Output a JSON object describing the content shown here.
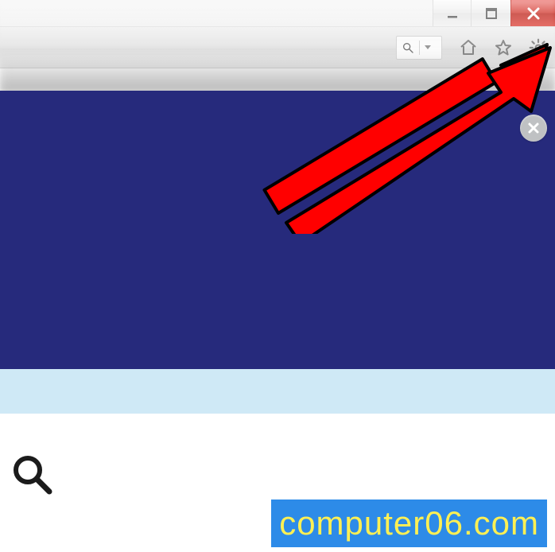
{
  "window": {
    "controls": {
      "minimize": "minimize-icon",
      "maximize": "maximize-icon",
      "close": "close-icon"
    }
  },
  "toolbar": {
    "search": {
      "placeholder": ""
    },
    "icons": {
      "search_dropdown": "search-dropdown-icon",
      "magnifier": "search-icon",
      "home": "home-icon",
      "star": "favorite-icon",
      "gear": "gear-icon"
    }
  },
  "content": {
    "close_banner": "close-icon"
  },
  "bottom": {
    "magnifier": "search-icon"
  },
  "watermark": {
    "text": "computer06.com"
  },
  "annotation": {
    "target": "gear-icon"
  },
  "colors": {
    "navy": "#262a7c",
    "lightbar": "#cfe9f6",
    "watermark_bg": "#2d8be8",
    "watermark_fg": "#fff053",
    "close_btn": "#d64b43"
  }
}
